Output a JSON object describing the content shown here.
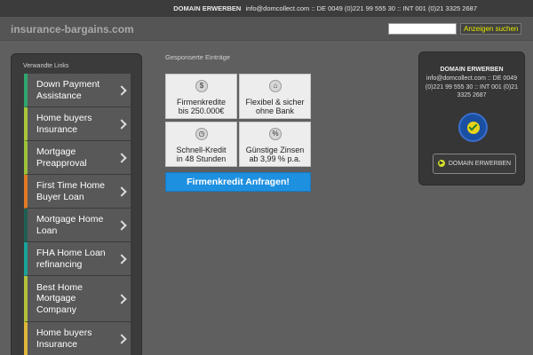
{
  "topbar": {
    "label": "DOMAIN ERWERBEN",
    "contact": "info@domcollect.com :: DE 0049 (0)221 99 555 30 :: INT 001 (0)21 3325 2687"
  },
  "header": {
    "site_title": "insurance-bargains.com",
    "search_placeholder": "",
    "search_button": "Anzeigen suchen"
  },
  "sidebar": {
    "title": "Verwandte Links",
    "links": [
      {
        "label": "Down Payment Assistance",
        "color": "#2fa66e"
      },
      {
        "label": "Home buyers Insurance",
        "color": "#a8c63a"
      },
      {
        "label": "Mortgage Preapproval",
        "color": "#9bc23a"
      },
      {
        "label": "First Time Home Buyer Loan",
        "color": "#e07a26"
      },
      {
        "label": "Mortgage Home Loan",
        "color": "#1f5f55"
      },
      {
        "label": "FHA Home Loan refinancing",
        "color": "#1aa39a"
      },
      {
        "label": "Best Home Mortgage Company",
        "color": "#b3c13a"
      },
      {
        "label": "Home buyers Insurance",
        "color": "#e0b63a"
      }
    ]
  },
  "main": {
    "section_title": "Gesponserte Einträge",
    "tiles": [
      {
        "icon": "coins-icon",
        "line1": "Firmenkredite",
        "line2": "bis 250.000€"
      },
      {
        "icon": "bank-icon",
        "line1": "Flexibel & sicher",
        "line2": "ohne Bank"
      },
      {
        "icon": "clock-icon",
        "line1": "Schnell-Kredit",
        "line2": "in 48 Stunden"
      },
      {
        "icon": "percent-icon",
        "line1": "Günstige Zinsen",
        "line2": "ab 3,99 % p.a."
      }
    ],
    "cta_label": "Firmenkredit Anfragen!"
  },
  "rightbox": {
    "title": "DOMAIN ERWERBEN",
    "contact": "info@domcollect.com :: DE 0049 (0)221 99 555 30 :: INT 001 (0)21 3325 2687",
    "button_label": "DOMAIN ERWERBEN",
    "seal_icon": "trusted-seal-icon"
  }
}
